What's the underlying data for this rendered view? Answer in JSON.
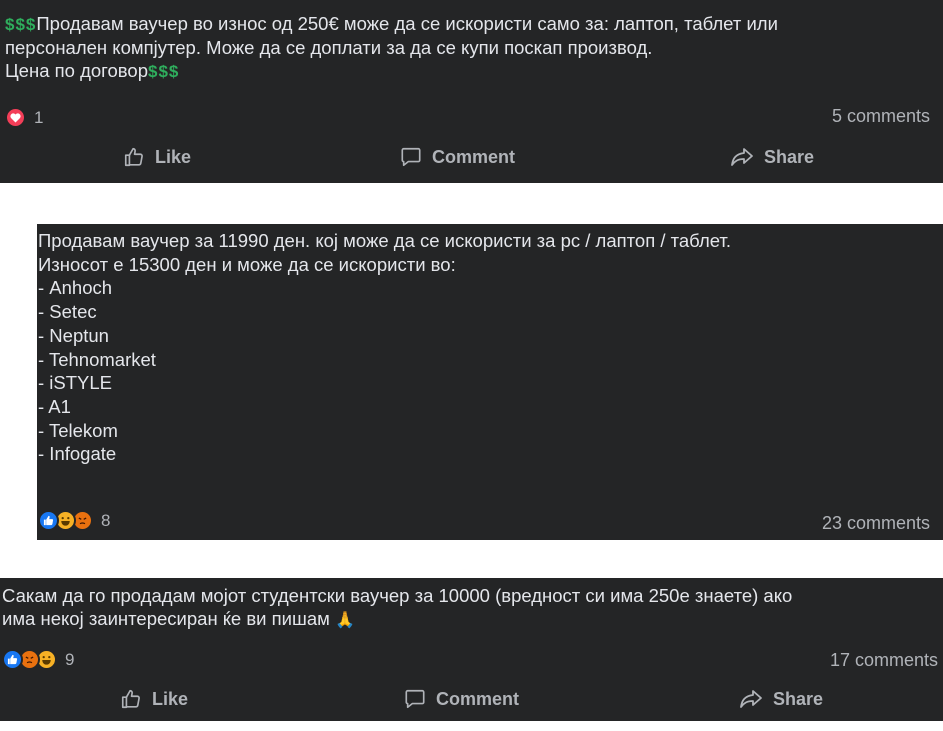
{
  "posts": [
    {
      "text_prefix": "$$$",
      "text": "Продавам ваучер во износ од 250€ може да се искористи само за: лаптоп, таблет или\nперсонален компјутер. Може да се доплати за да се купи поскап производ.\nЦена по договор",
      "text_suffix": "$$$",
      "reaction_icons": [
        "heart-icon"
      ],
      "reaction_count": "1",
      "comments": "5 comments",
      "actions": {
        "like": "Like",
        "comment": "Comment",
        "share": "Share"
      }
    },
    {
      "text": "Продавам ваучер за 11990 ден. кој може да се искористи за pc / лаптоп / таблет.\nИзносот е 15300 ден и може да се искористи во:\n- Anhoch\n- Setec\n- Neptun\n- Tehnomarket\n- iSTYLE\n- A1\n- Telekom\n- Infogate",
      "reaction_icons": [
        "like-icon",
        "haha-icon",
        "angry-icon"
      ],
      "reaction_count": "8",
      "comments": "23 comments"
    },
    {
      "text": "Сакам да го продадам мојот студентски ваучер за 10000 (вредност си има 250е знаете) ако\nима некој заинтересиран ќе ви пишам",
      "text_emoji": "🙏",
      "reaction_icons": [
        "like-icon",
        "angry-icon",
        "haha-icon"
      ],
      "reaction_count": "9",
      "comments": "17 comments",
      "actions": {
        "like": "Like",
        "comment": "Comment",
        "share": "Share"
      }
    }
  ],
  "colors": {
    "card_bg": "#242526",
    "text": "#e4e6eb",
    "secondary_text": "#b0b3b8",
    "dollar_green": "#2fae5d",
    "love_red": "#f33e58",
    "like_blue": "#1877f2"
  }
}
